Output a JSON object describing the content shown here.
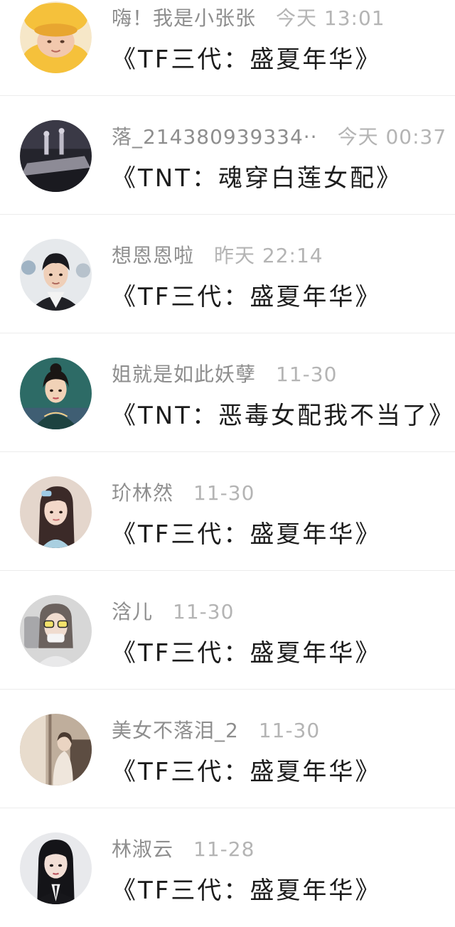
{
  "conversations": [
    {
      "name": "嗨！我是小张张",
      "time": "今天 13:01",
      "title": "《TF三代：盛夏年华》",
      "avatar_icon": "duck-hat-avatar-icon",
      "avatar_colors": [
        "#f5c13b",
        "#fbe3a0",
        "#e9b98f"
      ]
    },
    {
      "name": "落_214380939334··",
      "time": "今天 00:37",
      "title": "《TNT：魂穿白莲女配》",
      "avatar_icon": "concert-stage-avatar-icon",
      "avatar_colors": [
        "#2a2a33",
        "#6f6d78",
        "#b9b6c2"
      ]
    },
    {
      "name": "想恩恩啦",
      "time": "昨天 22:14",
      "title": "《TF三代：盛夏年华》",
      "avatar_icon": "boy-portrait-avatar-icon",
      "avatar_colors": [
        "#e9ecef",
        "#1d1d22",
        "#efcfb8"
      ]
    },
    {
      "name": "姐就是如此妖孽",
      "time": "11-30",
      "title": "《TNT：恶毒女配我不当了》",
      "avatar_icon": "qipao-girl-avatar-icon",
      "avatar_colors": [
        "#2f6f6a",
        "#1c3f3e",
        "#f1d2b7"
      ]
    },
    {
      "name": "玠林然",
      "time": "11-30",
      "title": "《TF三代：盛夏年华》",
      "avatar_icon": "girl-selfie-avatar-icon",
      "avatar_colors": [
        "#d8c7bd",
        "#3b2a28",
        "#f3d8c9"
      ]
    },
    {
      "name": "浛儿",
      "time": "11-30",
      "title": "《TF三代：盛夏年华》",
      "avatar_icon": "sunglasses-girl-avatar-icon",
      "avatar_colors": [
        "#c8c8c8",
        "#7a7a7a",
        "#f3e26b"
      ]
    },
    {
      "name": "美女不落泪_2",
      "time": "11-30",
      "title": "《TF三代：盛夏年华》",
      "avatar_icon": "window-girl-avatar-icon",
      "avatar_colors": [
        "#c9b7a4",
        "#8a7768",
        "#eee3d8"
      ]
    },
    {
      "name": "林淑云",
      "time": "11-28",
      "title": "《TF三代：盛夏年华》",
      "avatar_icon": "suit-girl-avatar-icon",
      "avatar_colors": [
        "#e6e7ea",
        "#141418",
        "#f2dfd6"
      ]
    }
  ]
}
